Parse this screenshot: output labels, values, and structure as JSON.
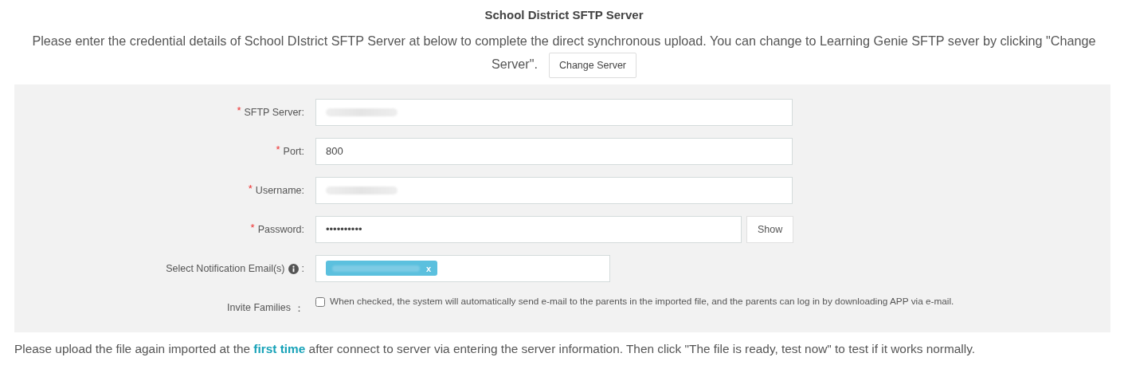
{
  "header": {
    "title": "School District SFTP Server",
    "intro_lines": [
      "Please enter the credential details of School DIstrict SFTP Server at below to complete the direct synchronous upload. You can change to Learning Genie SFTP sever by clicking \"Change",
      "Server\"."
    ],
    "button": "Change Server"
  },
  "form": {
    "fields": [
      {
        "kind": "text",
        "label": "SFTP Server:",
        "required_mark": "*",
        "redacted": true
      },
      {
        "kind": "text",
        "label": "Port:",
        "required_mark": "*",
        "value": "800"
      },
      {
        "kind": "text",
        "label": "Username:",
        "required_mark": "*",
        "redacted": true
      },
      {
        "kind": "password",
        "label": "Password:",
        "required_mark": "*",
        "value": "••••••••••",
        "button": "Show"
      },
      {
        "kind": "tags",
        "label": "Select Notification Email(s)",
        "suffix": ":",
        "tags": [
          {
            "redacted": true,
            "remove": "x"
          }
        ]
      },
      {
        "kind": "checkbox",
        "label": "Invite Families",
        "suffix": "：",
        "checked": false,
        "text": "When checked, the system will automatically send e-mail to the parents in the imported file, and the parents can log in by downloading APP via e-mail."
      }
    ]
  },
  "note": "Please upload the file again imported at the **first time** after connect to server via entering the server information. Then click \"The file is ready, test now\" to test if it works normally."
}
